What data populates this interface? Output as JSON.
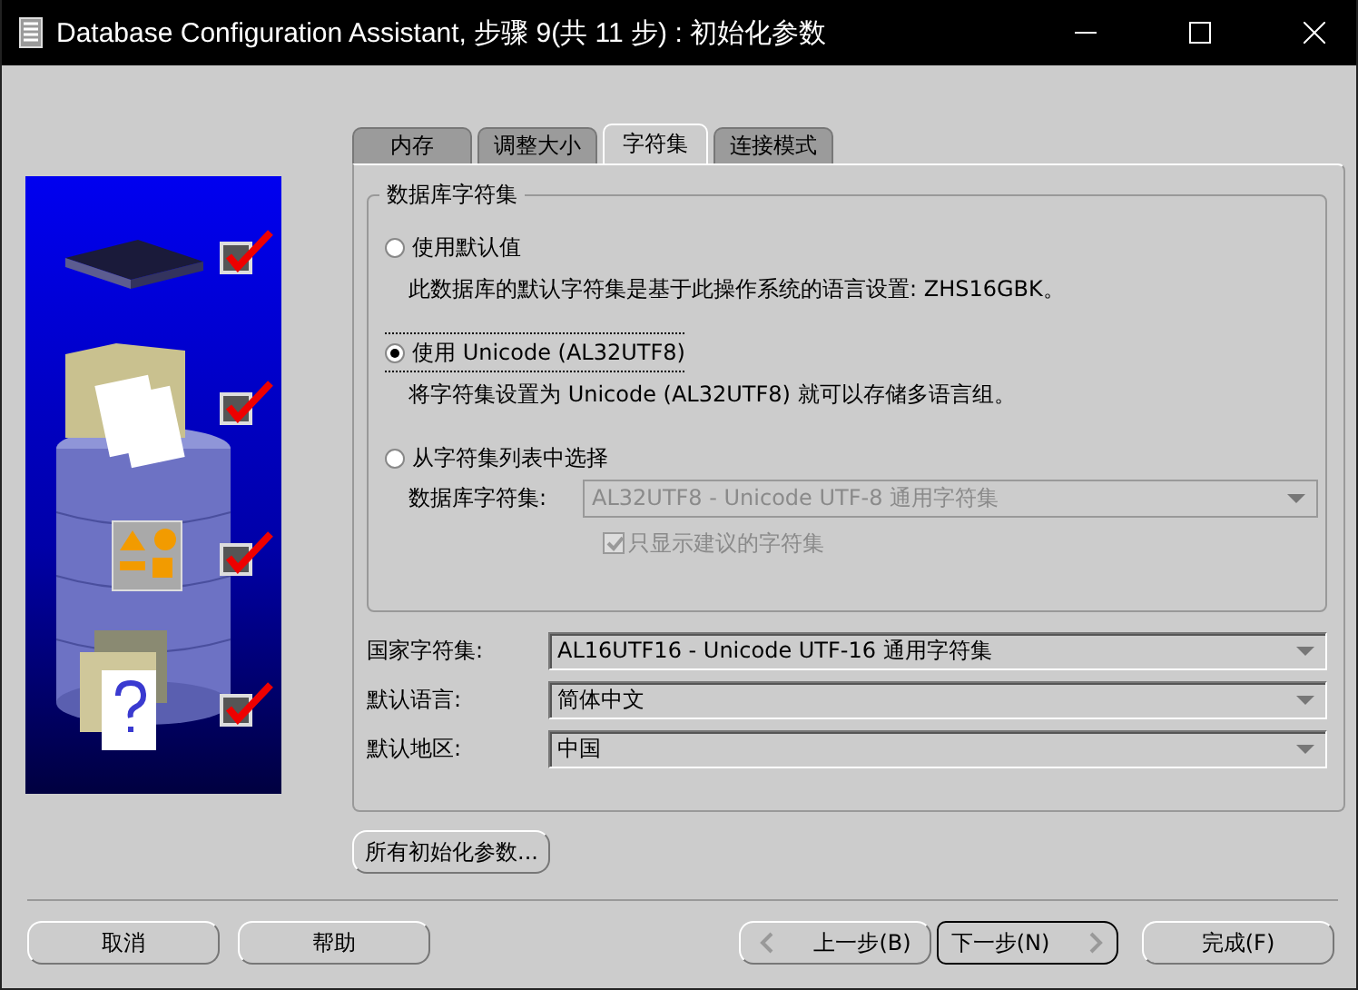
{
  "window": {
    "title": "Database Configuration Assistant, 步骤 9(共 11 步) : 初始化参数"
  },
  "steps": [
    {
      "checked": true
    },
    {
      "checked": true
    },
    {
      "checked": true
    },
    {
      "checked": true
    }
  ],
  "tabs": [
    {
      "label": "内存",
      "selected": false
    },
    {
      "label": "调整大小",
      "selected": false
    },
    {
      "label": "字符集",
      "selected": true
    },
    {
      "label": "连接模式",
      "selected": false
    }
  ],
  "database_charset": {
    "legend": "数据库字符集",
    "options": [
      {
        "label": "使用默认值",
        "selected": false,
        "focused": false,
        "description": "此数据库的默认字符集是基于此操作系统的语言设置: ZHS16GBK。"
      },
      {
        "label": "使用 Unicode (AL32UTF8)",
        "selected": true,
        "focused": true,
        "description": "将字符集设置为 Unicode (AL32UTF8) 就可以存储多语言组。"
      },
      {
        "label": "从字符集列表中选择",
        "selected": false,
        "focused": false
      }
    ],
    "charset_field": {
      "label": "数据库字符集:",
      "value": "AL32UTF8 - Unicode UTF-8 通用字符集",
      "disabled": true
    },
    "recommended_only": {
      "label": "只显示建议的字符集",
      "checked": true,
      "disabled": true
    }
  },
  "fields": [
    {
      "label": "国家字符集:",
      "value": "AL16UTF16 - Unicode UTF-16 通用字符集"
    },
    {
      "label": "默认语言:",
      "value": "简体中文"
    },
    {
      "label": "默认地区:",
      "value": "中国"
    }
  ],
  "all_params_button": "所有初始化参数...",
  "buttons_left": [
    "取消",
    "帮助"
  ],
  "nav_buttons": [
    {
      "label": "上一步(B)",
      "kind": "back"
    },
    {
      "label": "下一步(N)",
      "kind": "next"
    },
    {
      "label": "完成(F)",
      "kind": "plain"
    }
  ]
}
